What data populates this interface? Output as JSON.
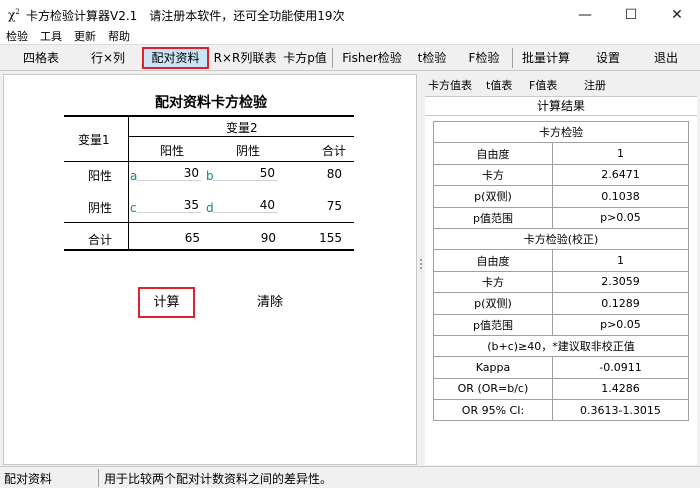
{
  "window": {
    "icon_text": "χ²",
    "title": "卡方检验计算器V2.1",
    "registration_note": "请注册本软件，还可全功能使用19次"
  },
  "menu": [
    "检验",
    "工具",
    "更新",
    "帮助"
  ],
  "toolbar": {
    "items": [
      "四格表",
      "行×列",
      "配对资料",
      "R×R列联表",
      "卡方p值",
      "Fisher检验",
      "t检验",
      "F检验",
      "批量计算",
      "设置",
      "退出"
    ],
    "active": "配对资料"
  },
  "left": {
    "title": "配对资料卡方检验",
    "var1_label": "变量1",
    "var2_label": "变量2",
    "col_headers": [
      "阳性",
      "阴性",
      "合计"
    ],
    "rows": [
      {
        "label": "阳性",
        "letter1": "a",
        "value1": "30",
        "letter2": "b",
        "value2": "50",
        "total": "80"
      },
      {
        "label": "阴性",
        "letter1": "c",
        "value1": "35",
        "letter2": "d",
        "value2": "40",
        "total": "75"
      }
    ],
    "total_row": {
      "label": "合计",
      "values": [
        "65",
        "90",
        "155"
      ]
    },
    "calc_button": "计算",
    "clear_button": "清除"
  },
  "right": {
    "tabs": [
      "卡方值表",
      "t值表",
      "F值表",
      "注册"
    ],
    "result_header": "计算结果",
    "sections": [
      {
        "title": "卡方检验",
        "rows": [
          {
            "label": "自由度",
            "value": "1"
          },
          {
            "label": "卡方",
            "value": "2.6471"
          },
          {
            "label": "p(双侧)",
            "value": "0.1038"
          },
          {
            "label": "p值范围",
            "value": "p>0.05"
          }
        ]
      },
      {
        "title": "卡方检验(校正)",
        "rows": [
          {
            "label": "自由度",
            "value": "1"
          },
          {
            "label": "卡方",
            "value": "2.3059"
          },
          {
            "label": "p(双侧)",
            "value": "0.1289"
          },
          {
            "label": "p值范围",
            "value": "p>0.05"
          }
        ]
      }
    ],
    "note": "(b+c)≥40，*建议取非校正值",
    "extra_rows": [
      {
        "label": "Kappa",
        "value": "-0.0911"
      },
      {
        "label": "OR (OR=b/c)",
        "value": "1.4286"
      },
      {
        "label": "OR 95% CI:",
        "value": "0.3613-1.3015"
      }
    ]
  },
  "status": {
    "left": "配对资料",
    "right": "用于比较两个配对计数资料之间的差异性。"
  }
}
